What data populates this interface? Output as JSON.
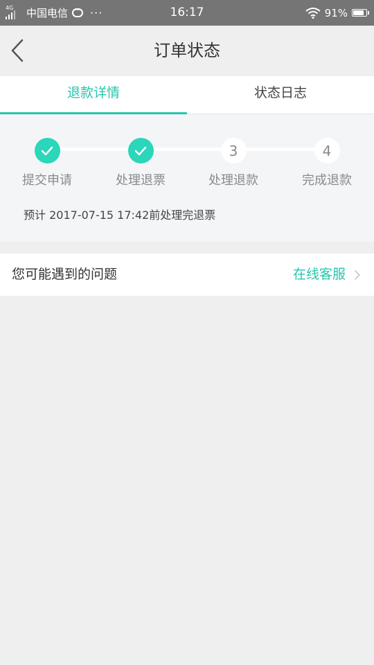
{
  "status_bar": {
    "network": "4G",
    "carrier": "中国电信",
    "more": "···",
    "time": "16:17",
    "battery_percent": "91%",
    "battery_level": 0.91
  },
  "header": {
    "title": "订单状态"
  },
  "tabs": [
    {
      "label": "退款详情",
      "active": true
    },
    {
      "label": "状态日志",
      "active": false
    }
  ],
  "progress": {
    "steps": [
      {
        "label": "提交申请",
        "state": "done",
        "number": ""
      },
      {
        "label": "处理退票",
        "state": "done",
        "number": ""
      },
      {
        "label": "处理退款",
        "state": "todo",
        "number": "3"
      },
      {
        "label": "完成退款",
        "state": "todo",
        "number": "4"
      }
    ],
    "estimate_text": "预计 2017-07-15 17:42前处理完退票"
  },
  "problems": {
    "label": "您可能遇到的问题",
    "link": "在线客服"
  },
  "colors": {
    "accent": "#26c6ad",
    "step_done": "#2bd6ba",
    "status_bar": "#757575",
    "page_bg": "#efefef"
  }
}
